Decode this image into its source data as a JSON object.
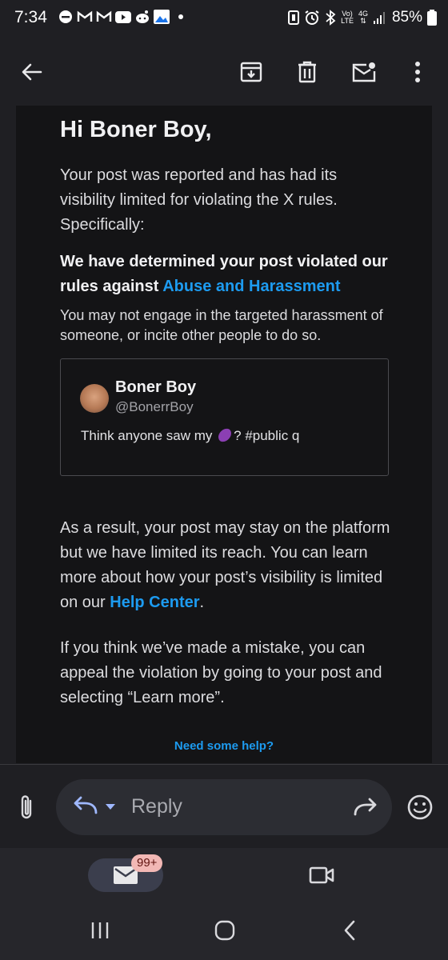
{
  "status_bar": {
    "time": "7:34",
    "network_label_1": "Vo)",
    "network_label_2": "LTE",
    "network_type": "4G",
    "battery": "85%"
  },
  "toolbar": {
    "icons": [
      "back-arrow-icon",
      "archive-icon",
      "delete-icon",
      "mark-unread-icon",
      "more-vert-icon"
    ]
  },
  "email": {
    "greeting": "Hi Boner Boy,",
    "intro": "Your post was reported and has had its visibility limited for violating the X rules. Specifically:",
    "rule_heading": "We have determined your post violated our rules against",
    "rule_link": "Abuse and Harassment",
    "rule_description": "You may not engage in the targeted harassment of someone, or incite other people to do so.",
    "post": {
      "display_name": "Boner Boy",
      "handle": "@BonerrBoy",
      "text_before": "Think anyone saw my",
      "text_after": "? #public q"
    },
    "result_text": "As a result, your post may stay on the platform but we have limited its reach. You can learn more about how your post’s visibility is limited on our",
    "help_center_link": "Help Center",
    "result_end": ".",
    "appeal_text": "If you think we’ve made a mistake, you can appeal the violation by going to your post and selecting “Learn more”.",
    "need_help": "Need some help?"
  },
  "reply_bar": {
    "reply_label": "Reply"
  },
  "bottom_nav": {
    "mail_badge": "99+"
  },
  "colors": {
    "link": "#1d9bf0",
    "background": "#1f1f23",
    "email_background": "#141416",
    "accent_reply": "#9fb8ff"
  }
}
